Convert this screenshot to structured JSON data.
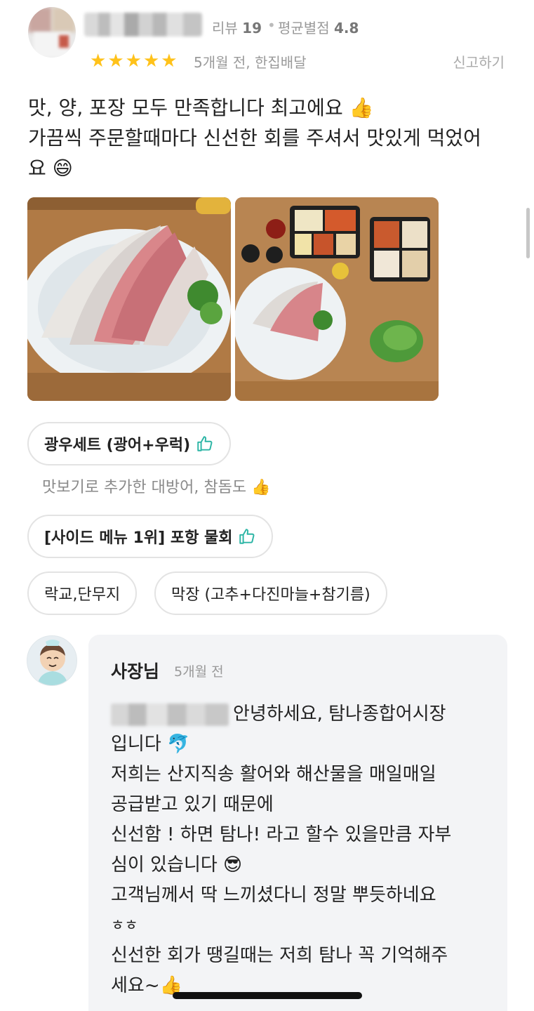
{
  "header": {
    "review_label": "리뷰",
    "review_count": "19",
    "separator": "•",
    "avg_label": "평균별점",
    "avg_rating": "4.8",
    "star_count": 5,
    "star_color": "#ffc21a",
    "meta": "5개월 전, 한집배달",
    "report_label": "신고하기"
  },
  "review": {
    "lines": [
      "맛, 양, 포장 모두 만족합니다 최고에요 👍",
      "가끔씩 주문할때마다 신선한 회를 주셔서 맛있게 먹었어",
      "요 😄"
    ]
  },
  "menus": {
    "item1": "광우세트 (광어+우럭)",
    "item1_comment": "맛보기로 추가한 대방어, 참돔도 👍",
    "item2": "[사이드 메뉴 1위] 포항 물회",
    "item3": "락교,단무지",
    "item4": "막장 (고추+다진마늘+참기름)"
  },
  "reply": {
    "owner_label": "사장님",
    "time": "5개월 전",
    "lines": [
      "안녕하세요, 탐나종합어시장",
      "입니다 🐬",
      "저희는 산지직송 활어와 해산물을 매일매일",
      "공급받고 있기 때문에",
      "신선함 ! 하면 탐나! 라고 할수 있을만큼 자부",
      "심이 있습니다 😎",
      "고객님께서 딱 느끼셨다니 정말 뿌듯하네요",
      "ㅎㅎ",
      "신선한 회가 땡길때는 저희 탐나 꼭 기억해주",
      "세요~👍"
    ]
  },
  "colors": {
    "card_bg": "#f3f4f6",
    "chip_border": "#e3e3e3",
    "accent_green": "#2cb5a5"
  }
}
